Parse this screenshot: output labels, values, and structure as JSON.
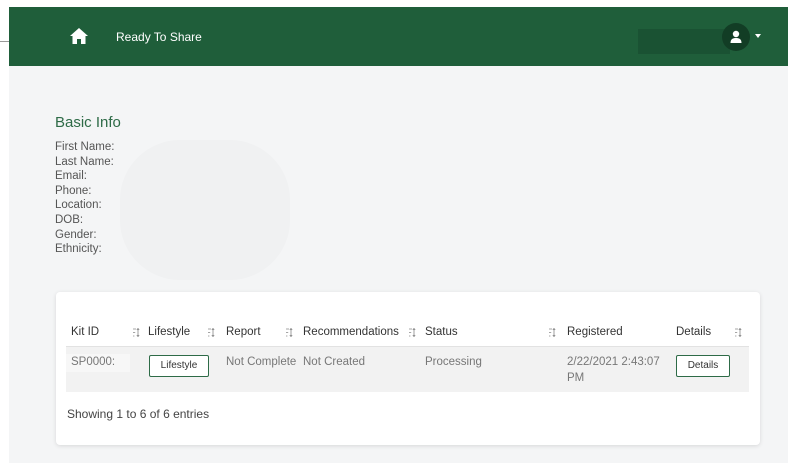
{
  "header": {
    "title": "Ready To Share",
    "home_icon": "home-icon",
    "account_icon": "user-icon",
    "bar_color": "#1f5e3a"
  },
  "basic_info": {
    "title": "Basic Info",
    "fields": [
      "First Name:",
      "Last Name:",
      "Email:",
      "Phone:",
      "Location:",
      "DOB:",
      "Gender:",
      "Ethnicity:"
    ]
  },
  "table": {
    "columns": [
      "Kit ID",
      "Lifestyle",
      "Report",
      "Recommendations",
      "Status",
      "Registered",
      "Details"
    ],
    "rows": [
      {
        "kit_id": "SP0000:",
        "lifestyle": "Lifestyle",
        "report": "Not Complete",
        "recommendations": "Not Created",
        "status": "Processing",
        "registered_line1": "2/22/2021 2:43:07",
        "registered_line2": "PM",
        "details": "Details"
      }
    ],
    "footer": "Showing 1 to 6 of 6 entries"
  }
}
